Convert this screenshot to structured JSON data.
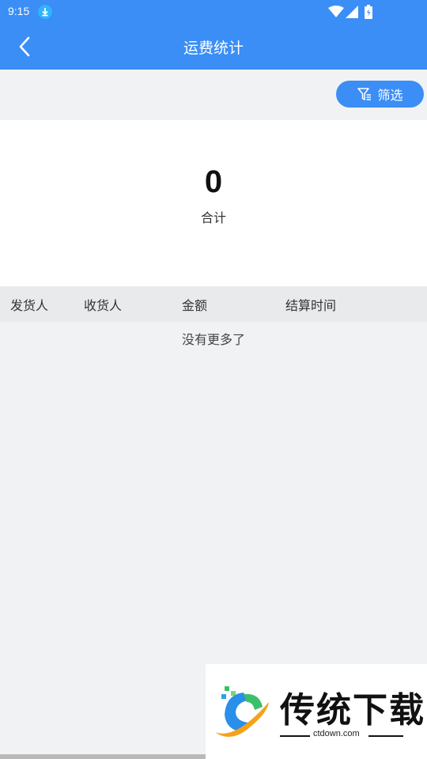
{
  "status_bar": {
    "time": "9:15",
    "icons": [
      "download-icon",
      "wifi-icon",
      "signal-icon",
      "battery-icon"
    ]
  },
  "header": {
    "title": "运费统计",
    "back_icon": "chevron-left-icon"
  },
  "filter": {
    "label": "筛选",
    "icon": "filter-icon"
  },
  "summary": {
    "total_value": "0",
    "total_label": "合计"
  },
  "table": {
    "columns": [
      "发货人",
      "收货人",
      "金额",
      "结算时间"
    ],
    "empty_text": "没有更多了"
  },
  "watermark": {
    "title": "传统下载",
    "url": "ctdown.com"
  },
  "colors": {
    "primary": "#3a8ef6",
    "background": "#f1f2f4",
    "header_row": "#e9eaec"
  }
}
